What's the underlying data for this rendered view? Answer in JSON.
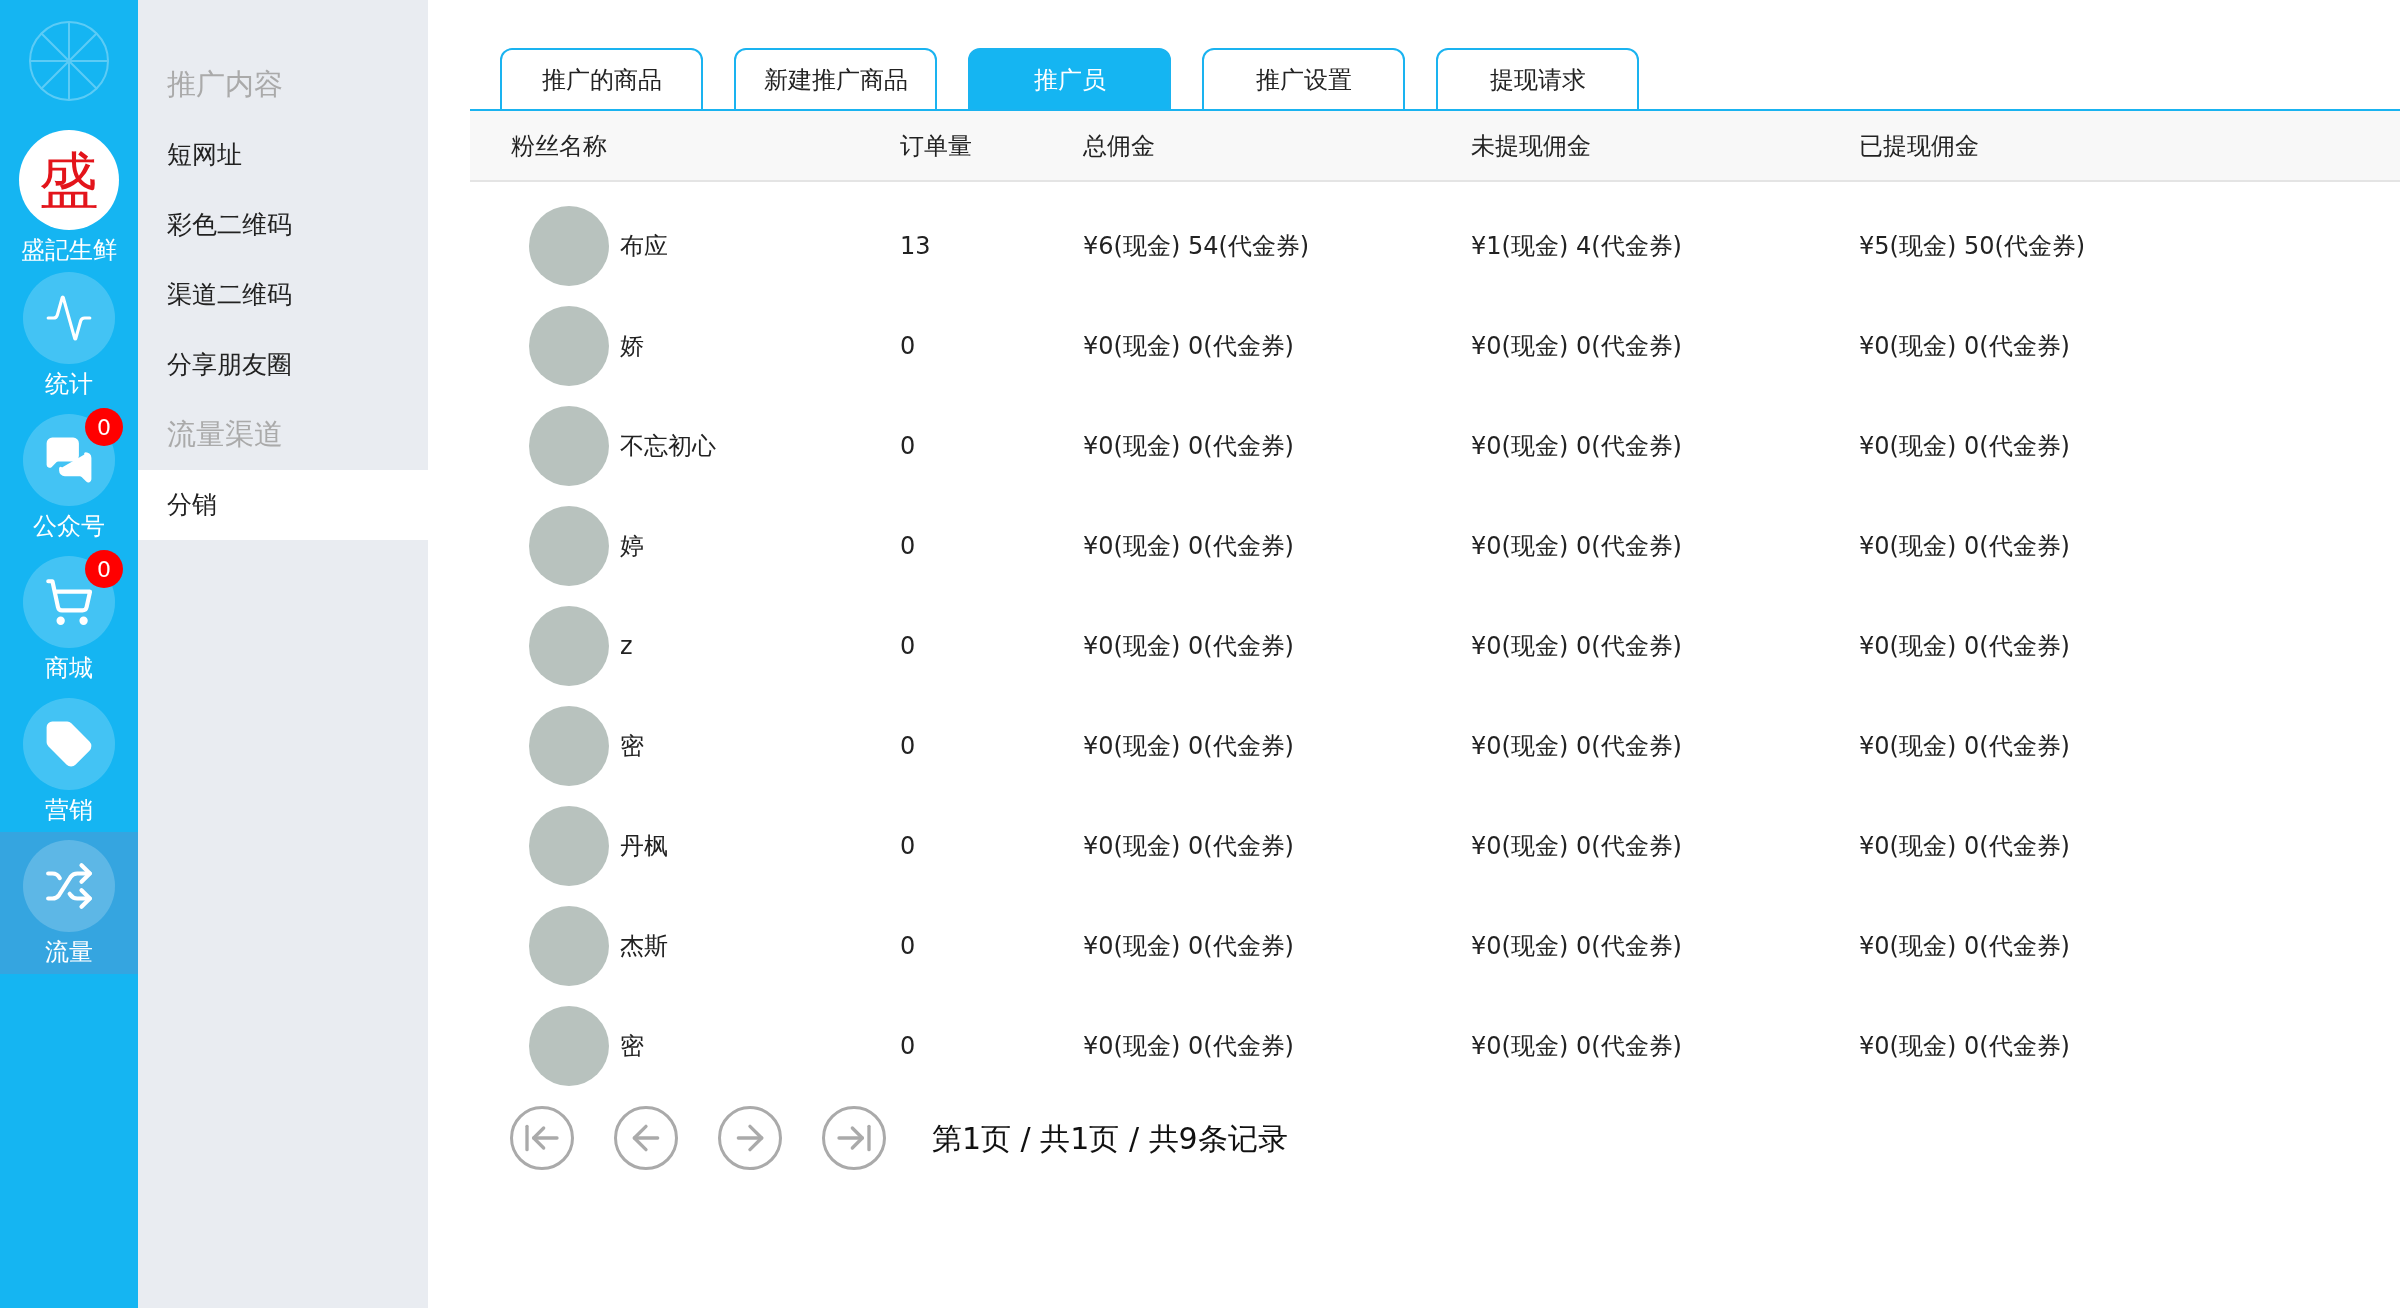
{
  "rail": {
    "items": [
      {
        "kind": "brand",
        "glyph": "盛",
        "label": "盛記生鲜",
        "selected": false
      },
      {
        "kind": "stats",
        "label": "统计",
        "selected": false
      },
      {
        "kind": "messages",
        "label": "公众号",
        "badge": "0",
        "selected": false
      },
      {
        "kind": "cart",
        "label": "商城",
        "badge": "0",
        "selected": false
      },
      {
        "kind": "tag",
        "label": "营销",
        "selected": false
      },
      {
        "kind": "shuffle",
        "label": "流量",
        "selected": true
      }
    ]
  },
  "submenu": {
    "items": [
      {
        "kind": "section",
        "label": "推广内容",
        "selected": false
      },
      {
        "kind": "link",
        "label": "短网址",
        "selected": false
      },
      {
        "kind": "link",
        "label": "彩色二维码",
        "selected": false
      },
      {
        "kind": "link",
        "label": "渠道二维码",
        "selected": false
      },
      {
        "kind": "link",
        "label": "分享朋友圈",
        "selected": false
      },
      {
        "kind": "section",
        "label": "流量渠道",
        "selected": false
      },
      {
        "kind": "link",
        "label": "分销",
        "selected": true
      }
    ]
  },
  "tabs": [
    {
      "label": "推广的商品",
      "selected": false
    },
    {
      "label": "新建推广商品",
      "selected": false
    },
    {
      "label": "推广员",
      "selected": true
    },
    {
      "label": "推广设置",
      "selected": false
    },
    {
      "label": "提现请求",
      "selected": false
    }
  ],
  "table": {
    "columns": [
      "粉丝名称",
      "订单量",
      "总佣金",
      "未提现佣金",
      "已提现佣金"
    ],
    "rows": [
      {
        "name": "布应",
        "orders": "13",
        "total": "¥6(现金) 54(代金券)",
        "unwithdrawn": "¥1(现金) 4(代金券)",
        "withdrawn": "¥5(现金) 50(代金券)"
      },
      {
        "name": "娇",
        "orders": "0",
        "total": "¥0(现金) 0(代金券)",
        "unwithdrawn": "¥0(现金) 0(代金券)",
        "withdrawn": "¥0(现金) 0(代金券)"
      },
      {
        "name": "不忘初心",
        "orders": "0",
        "total": "¥0(现金) 0(代金券)",
        "unwithdrawn": "¥0(现金) 0(代金券)",
        "withdrawn": "¥0(现金) 0(代金券)"
      },
      {
        "name": "婷",
        "orders": "0",
        "total": "¥0(现金) 0(代金券)",
        "unwithdrawn": "¥0(现金) 0(代金券)",
        "withdrawn": "¥0(现金) 0(代金券)"
      },
      {
        "name": "z",
        "orders": "0",
        "total": "¥0(现金) 0(代金券)",
        "unwithdrawn": "¥0(现金) 0(代金券)",
        "withdrawn": "¥0(现金) 0(代金券)"
      },
      {
        "name": "密",
        "orders": "0",
        "total": "¥0(现金) 0(代金券)",
        "unwithdrawn": "¥0(现金) 0(代金券)",
        "withdrawn": "¥0(现金) 0(代金券)"
      },
      {
        "name": "丹枫",
        "orders": "0",
        "total": "¥0(现金) 0(代金券)",
        "unwithdrawn": "¥0(现金) 0(代金券)",
        "withdrawn": "¥0(现金) 0(代金券)"
      },
      {
        "name": "杰斯",
        "orders": "0",
        "total": "¥0(现金) 0(代金券)",
        "unwithdrawn": "¥0(现金) 0(代金券)",
        "withdrawn": "¥0(现金) 0(代金券)"
      },
      {
        "name": "密",
        "orders": "0",
        "total": "¥0(现金) 0(代金券)",
        "unwithdrawn": "¥0(现金) 0(代金券)",
        "withdrawn": "¥0(现金) 0(代金券)"
      }
    ]
  },
  "pagination": {
    "summary": "第1页 / 共1页 / 共9条记录"
  }
}
